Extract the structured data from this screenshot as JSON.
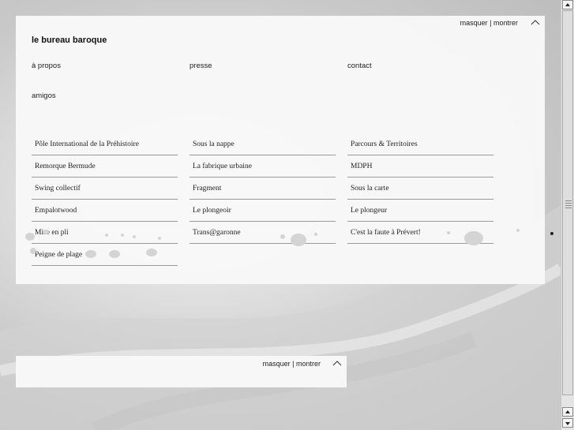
{
  "toggle_label": "masquer | montrer",
  "brand": "le bureau baroque",
  "nav": {
    "apropos": "à propos",
    "presse": "presse",
    "contact": "contact",
    "amigos": "amigos"
  },
  "projects": {
    "col_a": [
      "Pôle International de la Préhistoire",
      "Remorque Bermude",
      "Swing collectif",
      "Empalotwood",
      "Mise en pli",
      "Peigne de plage"
    ],
    "col_b": [
      "Sous la nappe",
      "La fabrique urbaine",
      "Fragment",
      "Le plongeoir",
      "Trans@garonne"
    ],
    "col_c": [
      "Parcours & Territoires",
      "MDPH",
      "Sous la carte",
      "Le plongeur",
      "C'est la faute à Prévert!"
    ]
  },
  "panel2": {
    "toggle_label": "masquer | montrer"
  },
  "icons": {
    "collapse": "chevron-up-icon",
    "scroll_up": "arrow-up-icon",
    "scroll_down": "arrow-down-icon"
  }
}
